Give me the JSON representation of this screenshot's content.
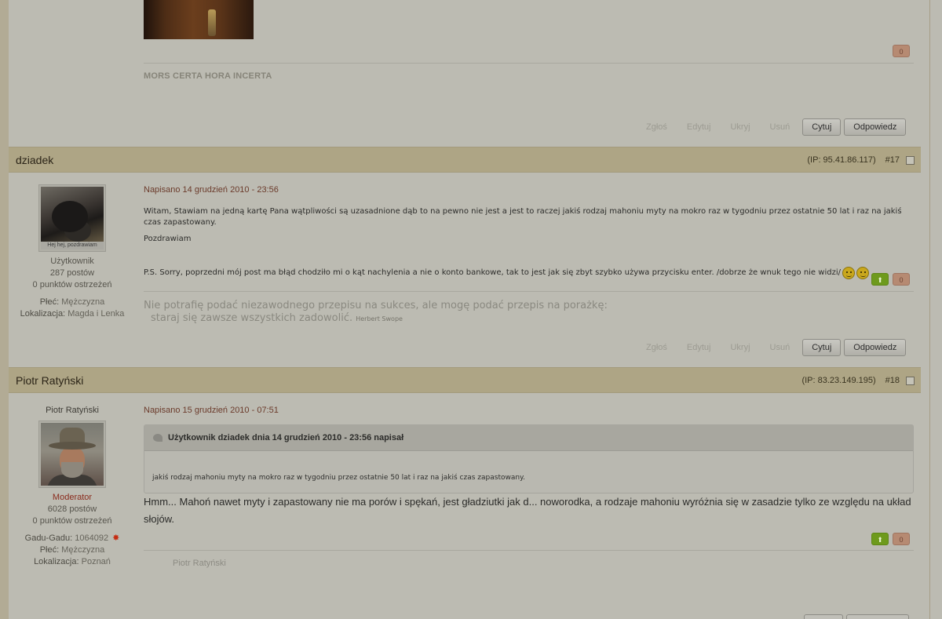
{
  "prev_post": {
    "vote_down_count": "0",
    "signature": "MORS CERTA HORA INCERTA",
    "actions": [
      "Zgłoś",
      "Edytuj",
      "Ukryj",
      "Usuń"
    ],
    "quote_label": "Cytuj",
    "reply_label": "Odpowiedz"
  },
  "post17": {
    "author": "dziadek",
    "ip": "(IP: 95.41.86.117)",
    "number": "#17",
    "avatar_caption": "Hej hej, pozdrawiam",
    "role": "Użytkownik",
    "posts": "287 postów",
    "warnings": "0 punktów ostrzeżeń",
    "gender_label": "Płeć:",
    "gender_value": "Mężczyzna",
    "location_label": "Lokalizacja:",
    "location_value": "Magda i Lenka",
    "date": "Napisano 14 grudzień 2010 - 23:56",
    "body_line1": "Witam, Stawiam na jedną kartę Pana wątpliwości są uzasadnione dąb to na pewno nie jest a jest to raczej jakiś rodzaj mahoniu myty na mokro raz w tygodniu przez ostatnie 50 lat i raz na jakiś czas zapastowany.",
    "body_line2": "Pozdrawiam",
    "body_line3": "P.S. Sorry, poprzedni mój post ma błąd chodziło mi o kąt nachylenia a nie o konto bankowe, tak to jest jak się zbyt szybko używa przycisku enter. /dobrze że wnuk tego nie widzi/",
    "vote_up_symbol": "⬆",
    "vote_down_count": "0",
    "signature_line1": "Nie potrafię podać niezawodnego przepisu na sukces, ale mogę podać przepis na porażkę:",
    "signature_line2": "staraj się zawsze wszystkich zadowolić.",
    "signature_author": "Herbert Swope",
    "actions": [
      "Zgłoś",
      "Edytuj",
      "Ukryj",
      "Usuń"
    ],
    "quote_label": "Cytuj",
    "reply_label": "Odpowiedz"
  },
  "post18": {
    "author": "Piotr Ratyński",
    "ip": "(IP: 83.23.149.195)",
    "number": "#18",
    "sidebar_name": "Piotr Ratyński",
    "role": "Moderator",
    "posts": "6028 postów",
    "warnings": "0 punktów ostrzeżeń",
    "gg_label": "Gadu-Gadu:",
    "gg_value": "1064092",
    "gg_icon": "✸",
    "gender_label": "Płeć:",
    "gender_value": "Mężczyzna",
    "location_label": "Lokalizacja:",
    "location_value": "Poznań",
    "date": "Napisano 15 grudzień 2010 - 07:51",
    "quote_header": "Użytkownik dziadek dnia 14 grudzień 2010 - 23:56 napisał",
    "quote_text": "jakiś rodzaj mahoniu myty na mokro raz w tygodniu przez ostatnie 50 lat i raz na jakiś czas zapastowany.",
    "reply_text": "Hmm... Mahoń nawet myty i zapastowany nie ma porów i spękań, jest gładziutki jak d... noworodka, a rodzaje mahoniu wyróżnia się w zasadzie tylko ze względu na układ słojów.",
    "vote_up_symbol": "⬆",
    "vote_down_count": "0",
    "signature": "Piotr Ratyński"
  }
}
